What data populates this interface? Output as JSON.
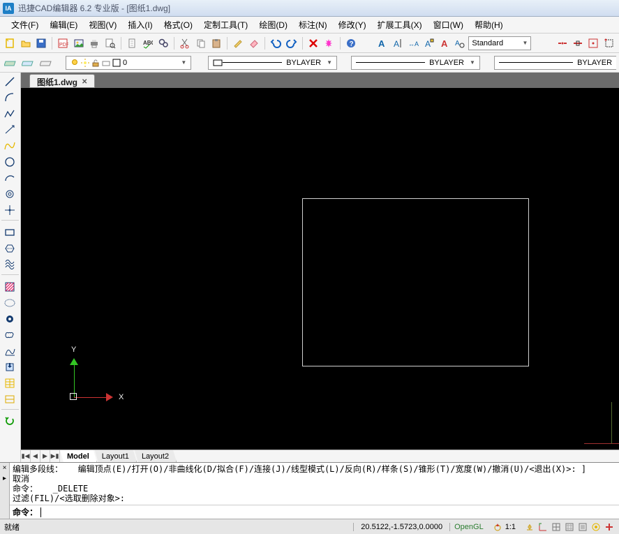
{
  "app": {
    "title": "迅捷CAD编辑器 6.2 专业版  - [图纸1.dwg]",
    "document": "图纸1.dwg"
  },
  "menu": {
    "file": "文件(F)",
    "edit": "编辑(E)",
    "view": "视图(V)",
    "insert": "插入(I)",
    "format": "格式(O)",
    "custom": "定制工具(T)",
    "draw": "绘图(D)",
    "annotate": "标注(N)",
    "modify": "修改(Y)",
    "extend": "扩展工具(X)",
    "window": "窗口(W)",
    "help": "帮助(H)"
  },
  "toolbar": {
    "style_label": "Standard"
  },
  "layerbar": {
    "current_layer": "0",
    "linetype1": "BYLAYER",
    "linetype2": "BYLAYER",
    "linetype3": "BYLAYER"
  },
  "modeltabs": {
    "model": "Model",
    "layout1": "Layout1",
    "layout2": "Layout2"
  },
  "ucs": {
    "x": "X",
    "y": "Y"
  },
  "command": {
    "history_line1": "编辑多段线：   编辑顶点(E)/打开(O)/非曲线化(D/拟合(F)/连接(J)/线型模式(L)/反向(R)/样条(S)/锥形(T)/宽度(W)/撤消(U)/<退出(X)>: ]",
    "history_line2": "取消",
    "history_line3": "命令：   _DELETE",
    "history_line4": "过滤(FIL)/<选取删除对象>:",
    "prompt": "命令："
  },
  "statusbar": {
    "ready": "就绪",
    "coords": "20.5122,-1.5723,0.0000",
    "renderer": "OpenGL",
    "scale": "1:1"
  }
}
